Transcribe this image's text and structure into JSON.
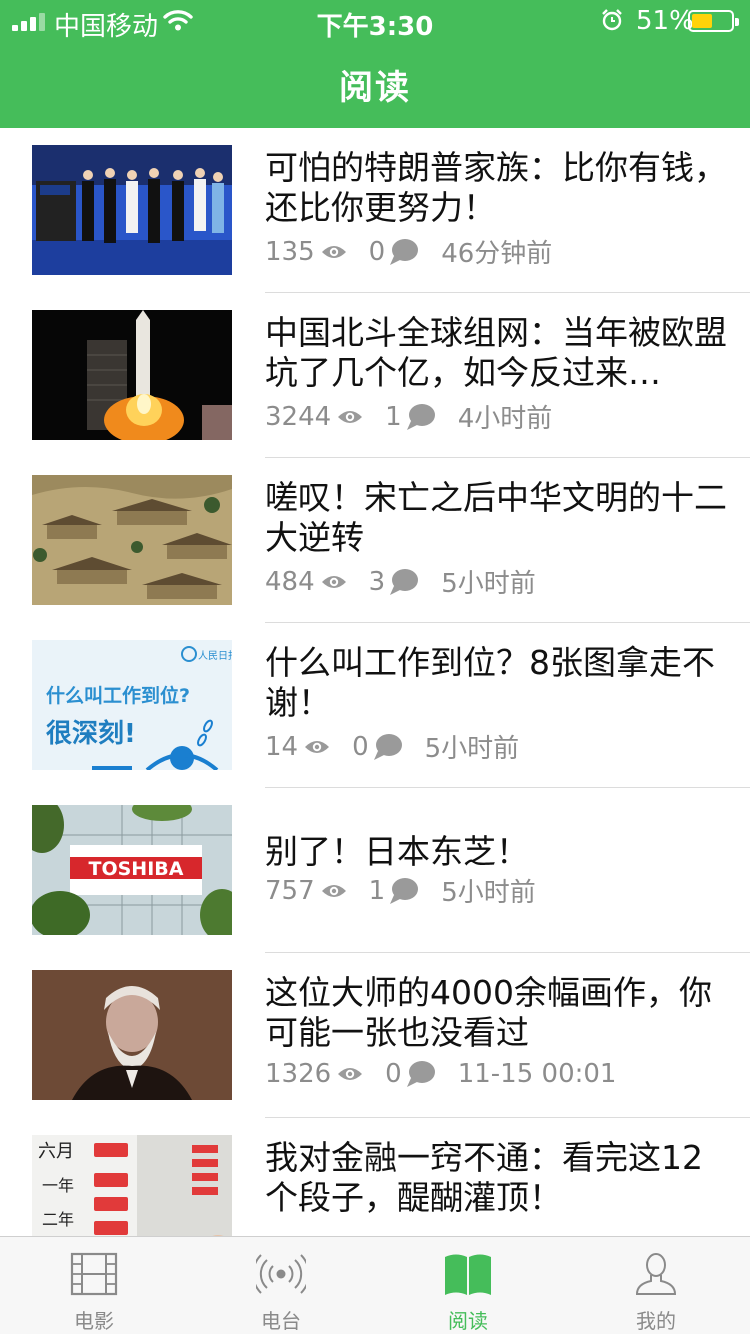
{
  "status_bar": {
    "carrier": "中国移动",
    "time": "下午3:30",
    "battery": "51%"
  },
  "header": {
    "title": "阅读"
  },
  "articles": [
    {
      "title": "可怕的特朗普家族：比你有钱，还比你更努力！",
      "views": "135",
      "comments": "0",
      "time": "46分钟前"
    },
    {
      "title": "中国北斗全球组网：当年被欧盟坑了几个亿，如今反过来…",
      "views": "3244",
      "comments": "1",
      "time": "4小时前"
    },
    {
      "title": "嗟叹！宋亡之后中华文明的十二大逆转",
      "views": "484",
      "comments": "3",
      "time": "5小时前"
    },
    {
      "title": "什么叫工作到位？8张图拿走不谢！",
      "views": "14",
      "comments": "0",
      "time": "5小时前",
      "thumb_text_1": "什么叫工作到位?",
      "thumb_text_2": "很深刻!",
      "thumb_logo": "人民日报"
    },
    {
      "title": "别了！日本东芝！",
      "views": "757",
      "comments": "1",
      "time": "5小时前",
      "thumb_text": "TOSHIBA"
    },
    {
      "title": "这位大师的4000余幅画作，你可能一张也没看过",
      "views": "1326",
      "comments": "0",
      "time": "11-15 00:01"
    },
    {
      "title": "我对金融一窍不通：看完这12个段子，醍醐灌顶！",
      "views": "",
      "comments": "",
      "time": "",
      "thumb_text_1": "六月",
      "thumb_text_2": "一年",
      "thumb_text_3": "二年"
    }
  ],
  "tabs": [
    {
      "label": "电影",
      "icon": "film-icon"
    },
    {
      "label": "电台",
      "icon": "radio-icon"
    },
    {
      "label": "阅读",
      "icon": "book-icon",
      "active": true
    },
    {
      "label": "我的",
      "icon": "user-icon"
    }
  ],
  "colors": {
    "brand": "#45bd5a",
    "meta": "#8c8c8c",
    "battery": "#ffd30a"
  }
}
